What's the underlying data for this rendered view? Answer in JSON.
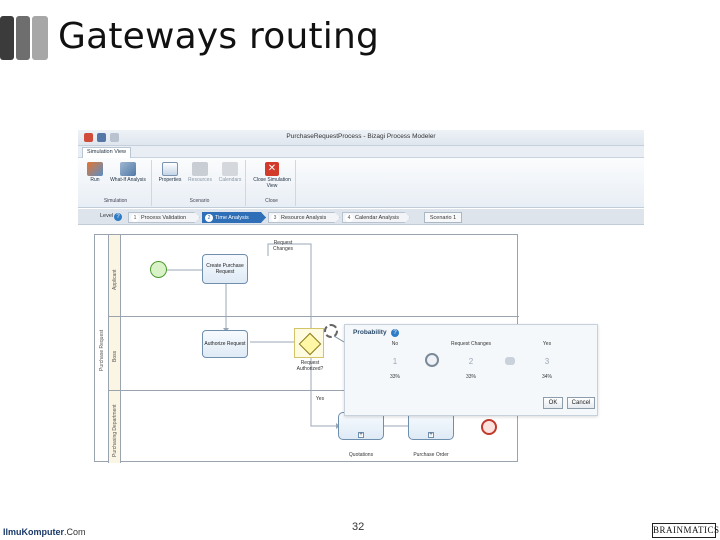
{
  "slide": {
    "title": "Gateways routing",
    "page_number": "32",
    "left_logo": {
      "name": "IlmuKomputer",
      "tld": ".Com"
    },
    "right_logo": "BRAINMATICS",
    "accent_colors": [
      "#3b3b3b",
      "#6e6e6e",
      "#a7a7a7"
    ]
  },
  "window": {
    "caption": "PurchaseRequestProcess - Bizagi Process Modeler"
  },
  "ribbon": {
    "tab": "Simulation View",
    "groups": [
      {
        "label": "Simulation",
        "buttons": [
          {
            "label": "Run",
            "icon": "run-icon"
          },
          {
            "label": "What-If Analysis",
            "icon": "what-if-icon"
          }
        ]
      },
      {
        "label": "Scenario",
        "buttons": [
          {
            "label": "Properties",
            "icon": "properties-icon"
          },
          {
            "label": "Resources",
            "icon": "resources-icon"
          },
          {
            "label": "Calendars",
            "icon": "calendars-icon"
          }
        ]
      },
      {
        "label": "Close",
        "buttons": [
          {
            "label": "Close Simulation View",
            "icon": "close-icon"
          }
        ]
      }
    ]
  },
  "levels": {
    "label": "Level",
    "steps": [
      {
        "num": "1",
        "label": "Process Validation"
      },
      {
        "num": "2",
        "label": "Time Analysis"
      },
      {
        "num": "3",
        "label": "Resource Analysis"
      },
      {
        "num": "4",
        "label": "Calendar Analysis"
      }
    ],
    "scenario": "Scenario 1"
  },
  "diagram": {
    "pool": "Purchase Request",
    "lanes": [
      "Applicant",
      "Boss",
      "Purchasing Department"
    ],
    "tasks": {
      "create": "Create Purchase Request",
      "authorize": "Authorize Request",
      "quotations": "Quotations",
      "purchase_order": "Purchase Order"
    },
    "gateway": "Request Authorized?",
    "flows": {
      "changes": "Request Changes",
      "yes": "Yes"
    }
  },
  "probability": {
    "title": "Probability",
    "columns": [
      {
        "name": "No",
        "num": "1",
        "pct": "33%"
      },
      {
        "name": "Request Changes",
        "num": "2",
        "pct": "33%"
      },
      {
        "name": "Yes",
        "num": "3",
        "pct": "34%"
      }
    ],
    "ok": "OK",
    "cancel": "Cancel"
  }
}
